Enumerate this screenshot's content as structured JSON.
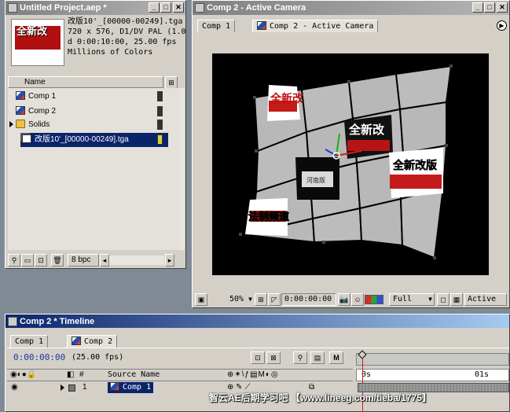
{
  "project": {
    "title": "Untitled Project.aep *",
    "info": {
      "name": "改版10'_[00000-00249].tga",
      "dims": "720 x 576, D1/DV PAL (1.0",
      "duration": "d 0:00:10:00, 25.00 fps",
      "colors": "Millions of Colors"
    },
    "column_name": "Name",
    "items": [
      {
        "label": "Comp 1",
        "icon": "composition-icon"
      },
      {
        "label": "Comp 2",
        "icon": "composition-icon"
      },
      {
        "label": "Solids",
        "icon": "folder-icon"
      },
      {
        "label": "改版10'_[00000-00249].tga",
        "icon": "footage-icon"
      }
    ],
    "bpc": "8 bpc"
  },
  "comp": {
    "title": "Comp 2 - Active Camera",
    "tabs": [
      "Comp 1",
      "Comp 2 - Active Camera"
    ],
    "zoom": "50%",
    "timecode": "0:00:00:00",
    "resolution": "Full",
    "view": "Active",
    "layer_texts": {
      "a": "全新改",
      "b": "全新改",
      "c": "全新改",
      "d": "全新改版",
      "e": "河南版",
      "f": "法制频道"
    }
  },
  "timeline": {
    "title": "Comp 2 * Timeline",
    "tabs": [
      "Comp 1",
      "Comp 2"
    ],
    "timecode": "0:00:00:00",
    "fps": "(25.00 fps)",
    "columns": {
      "num": "#",
      "source": "Source Name"
    },
    "ruler": {
      "start": "0s",
      "mark": "01s"
    },
    "layers": [
      {
        "num": "1",
        "name": "Comp 1"
      }
    ]
  },
  "watermark": "智云AE后期学习吧 【www.lineeg.com/tieba/1775】",
  "colors": {
    "active_title": "#0a246a",
    "inactive_title": "#808080",
    "face_bg": "#d4d0c8",
    "selection": "#0a246a"
  }
}
